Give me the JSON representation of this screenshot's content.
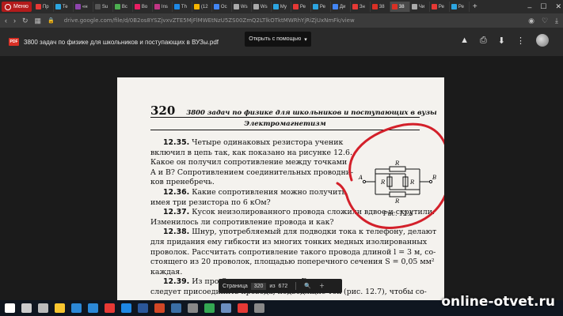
{
  "browser": {
    "menu_label": "Меню",
    "tabs": [
      {
        "label": "Пр",
        "color": "#e53935"
      },
      {
        "label": "Те",
        "color": "#2ca5e0"
      },
      {
        "label": "«н",
        "color": "#8e44ad"
      },
      {
        "label": "Su",
        "color": "#555555"
      },
      {
        "label": "Вс",
        "color": "#4caf50"
      },
      {
        "label": "Во",
        "color": "#e91e63"
      },
      {
        "label": "Ins",
        "color": "#c13584"
      },
      {
        "label": "Th",
        "color": "#1e88e5"
      },
      {
        "label": "(12",
        "color": "#f4b400"
      },
      {
        "label": "Ос",
        "color": "#4285f4"
      },
      {
        "label": "Ws",
        "color": "#aaaaaa"
      },
      {
        "label": "Ws",
        "color": "#aaaaaa"
      },
      {
        "label": "Му",
        "color": "#2ca5e0"
      },
      {
        "label": "Ре",
        "color": "#e53935"
      },
      {
        "label": "Ре",
        "color": "#2ca5e0"
      },
      {
        "label": "Ди",
        "color": "#4285f4"
      },
      {
        "label": "Зн",
        "color": "#e53935"
      },
      {
        "label": "38",
        "color": "#d93025"
      },
      {
        "label": "38",
        "color": "#d93025",
        "active": true
      },
      {
        "label": "Чи",
        "color": "#aaaaaa"
      },
      {
        "label": "Ре",
        "color": "#e53935"
      },
      {
        "label": "Ре",
        "color": "#2ca5e0"
      }
    ],
    "url": "drive.google.com/file/d/0B2os8YSZjvxvZTE5MjFlMWEtNzU5ZS00ZmQ2LTlkOTktMWRhYjRiZjUxNmFk/view"
  },
  "viewer": {
    "file_badge": "PDF",
    "file_title": "3800 задач по физике для школьников и поступающих в ВУЗы.pdf",
    "open_with": "Открыть с помощью"
  },
  "document": {
    "page_number": "320",
    "book_title": "3800 задач по физике для школьников и поступающих в вузы",
    "section": "Электромагнетизм",
    "lines": [
      {
        "num": "12.35.",
        "text": "Четыре одинаковых резистора ученик"
      },
      {
        "num": "",
        "text": "включил в цепь так, как показано на рисунке 12.6."
      },
      {
        "num": "",
        "text": "Какое он получил сопротивление между точками"
      },
      {
        "num": "",
        "text": "A и B? Сопротивлением соединительных проводни-"
      },
      {
        "num": "",
        "text": "ков пренебречь."
      },
      {
        "num": "12.36.",
        "text": "Какие сопротивления можно получить,"
      },
      {
        "num": "",
        "text": "имея три резистора по 6 кОм?"
      },
      {
        "num": "12.37.",
        "text": "Кусок неизолированного провода сложили вдвое и скрутили."
      },
      {
        "num": "",
        "text": "Изменилось ли сопротивление провода и как?"
      },
      {
        "num": "12.38.",
        "text": "Шнур, употребляемый для подводки тока к телефону, делают"
      },
      {
        "num": "",
        "text": "для придания ему гибкости из многих тонких медных изолированных"
      },
      {
        "num": "",
        "text": "проволок. Рассчитать сопротивление такого провода длиной l = 3 м, со-"
      },
      {
        "num": "",
        "text": "стоящего из 20 проволок, площадью поперечного сечения S = 0,05 мм²"
      },
      {
        "num": "",
        "text": "каждая."
      },
      {
        "num": "12.39.",
        "text": "Из про                                   Ом сделано кольцо. Где"
      },
      {
        "num": "",
        "text": "следует присоединить провода, подводящие ток (рис. 12.7), чтобы со-"
      }
    ],
    "figure": {
      "caption": "Рис. 12.6",
      "resistor_label": "R",
      "node_a": "A",
      "node_b": "B"
    }
  },
  "page_controls": {
    "page_label": "Страница",
    "current_page": "320",
    "of_label": "из",
    "total_pages": "672"
  },
  "watermark": "online-otvet.ru",
  "colors": {
    "opera_red": "#b31b1b",
    "pdf_red": "#d93025",
    "annotation_red": "#d3202a"
  },
  "taskbar": {
    "icons": [
      "start-icon",
      "search-icon",
      "task-view-icon",
      "explorer-icon",
      "store-icon",
      "mail-icon",
      "media-icon",
      "photos-icon",
      "word-icon",
      "powerpoint-icon",
      "app-icon",
      "app-icon",
      "chrome-icon",
      "app-icon",
      "opera-icon",
      "app-icon"
    ]
  }
}
